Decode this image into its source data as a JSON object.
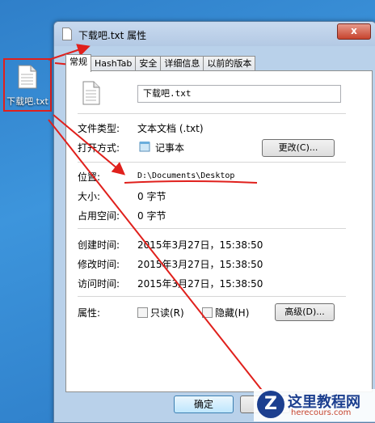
{
  "desktop": {
    "icon_label": "下载吧.txt"
  },
  "window": {
    "title": "下载吧.txt 属性",
    "close": "x"
  },
  "tabs": [
    {
      "label": "常规",
      "active": true
    },
    {
      "label": "HashTab"
    },
    {
      "label": "安全"
    },
    {
      "label": "详细信息"
    },
    {
      "label": "以前的版本"
    }
  ],
  "general": {
    "file_name": "下载吧.txt",
    "type_label": "文件类型:",
    "type_value": "文本文档 (.txt)",
    "opens_label": "打开方式:",
    "opens_value": "记事本",
    "change_button": "更改(C)...",
    "location_label": "位置:",
    "location_value": "D:\\Documents\\Desktop",
    "size_label": "大小:",
    "size_value": "0 字节",
    "disk_label": "占用空间:",
    "disk_value": "0 字节",
    "created_label": "创建时间:",
    "created_value": "2015年3月27日，15:38:50",
    "modified_label": "修改时间:",
    "modified_value": "2015年3月27日，15:38:50",
    "accessed_label": "访问时间:",
    "accessed_value": "2015年3月27日，15:38:50",
    "attr_label": "属性:",
    "readonly_label": "只读(R)",
    "hidden_label": "隐藏(H)",
    "advanced_button": "高级(D)..."
  },
  "buttons": {
    "ok": "确定"
  },
  "watermark": {
    "logo": "Z",
    "title": "这里教程网",
    "url": "herecours.com"
  },
  "colors": {
    "annotation": "#e0201c",
    "ok_border": "#3c7fb1"
  }
}
